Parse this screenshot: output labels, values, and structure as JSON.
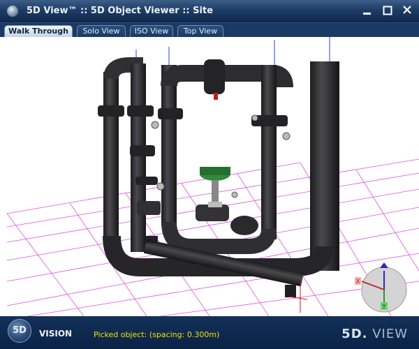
{
  "window": {
    "title": "5D View™ :: 5D Object Viewer :: Site",
    "controls": [
      "minimize-icon",
      "maximize-icon",
      "close-icon"
    ]
  },
  "tabs": [
    {
      "label": "Walk Through",
      "active": true
    },
    {
      "label": "Solo View",
      "active": false
    },
    {
      "label": "ISO View",
      "active": false
    },
    {
      "label": "Top View",
      "active": false
    }
  ],
  "viewport": {
    "grid_color": "#d633d6",
    "pipe_color": "#2a2a2c",
    "valve_color": "#2f8a3a",
    "orientation_gizmo": {
      "x_label": "X",
      "y_label": "Y"
    }
  },
  "status": {
    "logo_text": "5D",
    "vision_label": "VISION",
    "picked_text": "Picked object:  (spacing: 0.300m)",
    "brand_main": "5D.",
    "brand_suffix": " VIEW"
  }
}
